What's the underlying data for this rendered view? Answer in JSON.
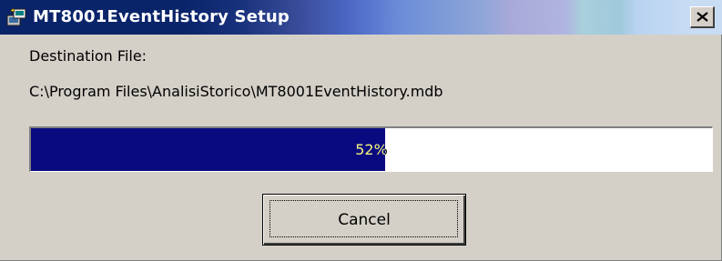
{
  "window": {
    "title": "MT8001EventHistory Setup",
    "icon": "setup-installer-icon",
    "close_icon": "close-icon"
  },
  "content": {
    "destination_label": "Destination File:",
    "destination_path": "C:\\Program Files\\AnalisiStorico\\MT8001EventHistory.mdb"
  },
  "progress": {
    "percent": 52,
    "label": "52%",
    "fill_color": "#0a0a80"
  },
  "buttons": {
    "cancel_label": "Cancel"
  },
  "colors": {
    "title_bar_start": "#0a246a",
    "dialog_face": "#d4d0c8"
  }
}
